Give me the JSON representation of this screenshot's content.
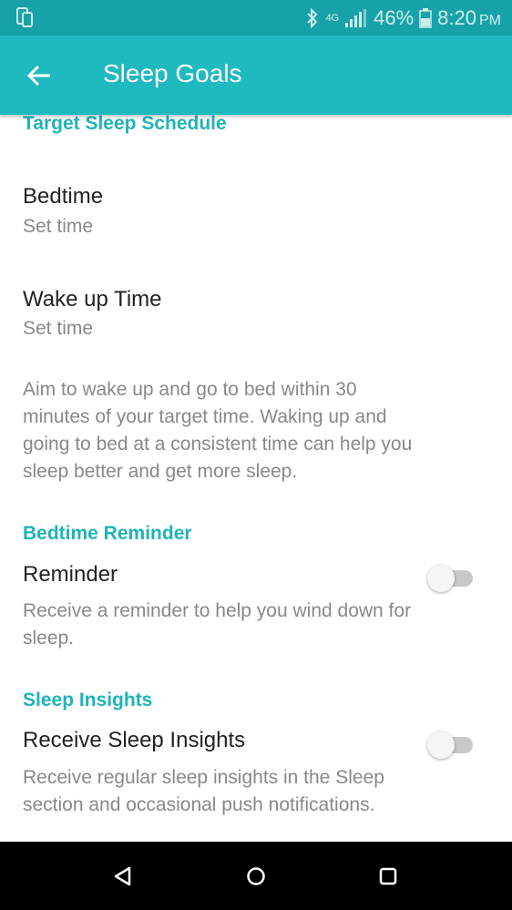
{
  "status_bar": {
    "battery_percent": "46%",
    "time": "8:20",
    "ampm": "PM",
    "network_label": "4G"
  },
  "app_bar": {
    "title": "Sleep Goals"
  },
  "target_schedule": {
    "header": "Target Sleep Schedule",
    "bedtime": {
      "title": "Bedtime",
      "value": "Set time"
    },
    "wakeup": {
      "title": "Wake up Time",
      "value": "Set time"
    },
    "description_lines": [
      "Aim to wake up and go to bed within 30",
      "minutes of your target time. Waking up and",
      "going to bed at a consistent time can help you",
      "sleep better and get more sleep."
    ]
  },
  "bedtime_reminder": {
    "header": "Bedtime Reminder",
    "title": "Reminder",
    "description_lines": [
      "Receive a reminder to help you wind down for",
      "sleep."
    ],
    "enabled": false
  },
  "sleep_insights": {
    "header": "Sleep Insights",
    "title": "Receive Sleep Insights",
    "description_lines": [
      "Receive regular sleep insights in the Sleep",
      "section and occasional push notifications."
    ],
    "enabled": false
  },
  "icons": {
    "status_left": "phone-icon",
    "bluetooth": "bluetooth-icon",
    "signal": "signal-icon",
    "battery": "battery-icon",
    "back": "arrow-left-icon",
    "nav_back": "triangle-back-icon",
    "nav_home": "circle-home-icon",
    "nav_recents": "square-recents-icon"
  },
  "colors": {
    "status_bar": "#17a2a9",
    "app_bar": "#1fb9c0",
    "section_header": "#1fb3ba",
    "primary_text": "#222222",
    "secondary_text": "#888888"
  }
}
